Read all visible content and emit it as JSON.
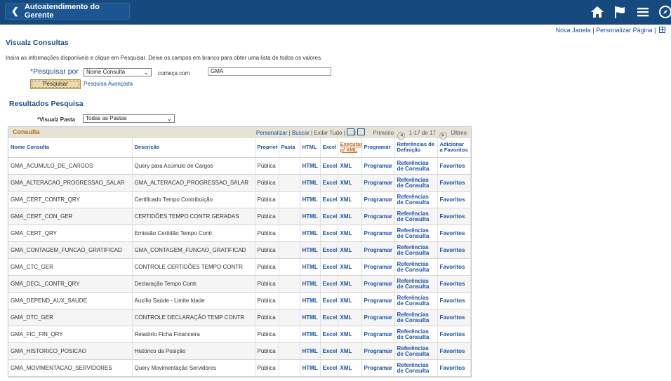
{
  "header": {
    "back_label": "Autoatendimento do Gerente",
    "links": {
      "new_window": "Nova Janela",
      "separator": "|",
      "personalize": "Personalizar Página"
    }
  },
  "page": {
    "title": "Visualz Consultas",
    "instructions": "Insira as informações disponíveis e clique em Pesquisar. Deixe os campos em branco para obter uma lista de todos os valores.",
    "search_by_label": "*Pesquisar por",
    "search_by_value": "Nome Consulta",
    "starts_with_label": "começa com",
    "search_text": "GMA",
    "search_button": "Pesquisar",
    "advanced_search": "Pesquisa Avançada"
  },
  "results": {
    "title": "Resultados Pesquisa",
    "folder_label": "*Visualz Pasta",
    "folder_value": "Todas as Pastas",
    "grid_title": "Consulta",
    "nav": {
      "personalize": "Personalizar",
      "find": "Buscar",
      "view_all": "Exibir Tudo",
      "first": "Primeiro",
      "range": "1-17 de 17",
      "last": "Último"
    },
    "columns": {
      "name": "Nome Consulta",
      "desc": "Descrição",
      "owner": "Propriet",
      "folder": "Pasta",
      "html": "HTML",
      "excel": "Excel",
      "xml": "Executar p/ XML",
      "schedule": "Programar",
      "refs": "Referências de Definição",
      "fav": "Adicionar a Favoritos"
    },
    "rows": [
      {
        "name": "GMA_ACUMULO_DE_CARGOS",
        "desc": "Query para Acúmulo de Cargos",
        "owner": "Pública",
        "folder": "",
        "html": "HTML",
        "excel": "Excel",
        "xml": "XML",
        "schedule": "Programar",
        "refs": "Referências de Consulta",
        "fav": "Favoritos"
      },
      {
        "name": "GMA_ALTERACAO_PROGRESSAO_SALAR",
        "desc": "GMA_ALTERACAO_PROGRESSAO_SALAR",
        "owner": "Pública",
        "folder": "",
        "html": "HTML",
        "excel": "Excel",
        "xml": "XML",
        "schedule": "Programar",
        "refs": "Referências de Consulta",
        "fav": "Favoritos"
      },
      {
        "name": "GMA_CERT_CONTR_QRY",
        "desc": "Certificado Tempo Contribuição",
        "owner": "Pública",
        "folder": "",
        "html": "HTML",
        "excel": "Excel",
        "xml": "XML",
        "schedule": "Programar",
        "refs": "Referências de Consulta",
        "fav": "Favoritos"
      },
      {
        "name": "GMA_CERT_CON_GER",
        "desc": "CERTIDÕES TEMPO CONTR GERADAS",
        "owner": "Pública",
        "folder": "",
        "html": "HTML",
        "excel": "Excel",
        "xml": "XML",
        "schedule": "Programar",
        "refs": "Referências de Consulta",
        "fav": "Favoritos"
      },
      {
        "name": "GMA_CERT_QRY",
        "desc": "Emissão Certidão Tempo Contr.",
        "owner": "Pública",
        "folder": "",
        "html": "HTML",
        "excel": "Excel",
        "xml": "XML",
        "schedule": "Programar",
        "refs": "Referências de Consulta",
        "fav": "Favoritos"
      },
      {
        "name": "GMA_CONTAGEM_FUNCAO_GRATIFICAD",
        "desc": "GMA_CONTAGEM_FUNCAO_GRATIFICAD",
        "owner": "Pública",
        "folder": "",
        "html": "HTML",
        "excel": "Excel",
        "xml": "XML",
        "schedule": "Programar",
        "refs": "Referências de Consulta",
        "fav": "Favoritos"
      },
      {
        "name": "GMA_CTC_GER",
        "desc": "CONTROLE CERTIDÕES TEMPO CONTR",
        "owner": "Pública",
        "folder": "",
        "html": "HTML",
        "excel": "Excel",
        "xml": "XML",
        "schedule": "Programar",
        "refs": "Referências de Consulta",
        "fav": "Favoritos"
      },
      {
        "name": "GMA_DECL_CONTR_QRY",
        "desc": "Declaração Tempo Contr.",
        "owner": "Pública",
        "folder": "",
        "html": "HTML",
        "excel": "Excel",
        "xml": "XML",
        "schedule": "Programar",
        "refs": "Referências de Consulta",
        "fav": "Favoritos"
      },
      {
        "name": "GMA_DEPEND_AUX_SAUDE",
        "desc": "Auxílio Saúde - Limite Idade",
        "owner": "Pública",
        "folder": "",
        "html": "HTML",
        "excel": "Excel",
        "xml": "XML",
        "schedule": "Programar",
        "refs": "Referências de Consulta",
        "fav": "Favoritos"
      },
      {
        "name": "GMA_DTC_GER",
        "desc": "CONTROLE DECLARAÇÃO TEMP CONTR",
        "owner": "Pública",
        "folder": "",
        "html": "HTML",
        "excel": "Excel",
        "xml": "XML",
        "schedule": "Programar",
        "refs": "Referências de Consulta",
        "fav": "Favoritos"
      },
      {
        "name": "GMA_FIC_FIN_QRY",
        "desc": "Relatório Ficha Financeira",
        "owner": "Pública",
        "folder": "",
        "html": "HTML",
        "excel": "Excel",
        "xml": "XML",
        "schedule": "Programar",
        "refs": "Referências de Consulta",
        "fav": "Favoritos"
      },
      {
        "name": "GMA_HISTORICO_POSICAO",
        "desc": "Histórico da Posição",
        "owner": "Pública",
        "folder": "",
        "html": "HTML",
        "excel": "Excel",
        "xml": "XML",
        "schedule": "Programar",
        "refs": "Referências de Consulta",
        "fav": "Favoritos"
      },
      {
        "name": "GMA_MOVIMENTACAO_SERVIDORES",
        "desc": "Query Movimentação Servidores",
        "owner": "Pública",
        "folder": "",
        "html": "HTML",
        "excel": "Excel",
        "xml": "XML",
        "schedule": "Programar",
        "refs": "Referências de Consulta",
        "fav": "Favoritos"
      }
    ]
  }
}
